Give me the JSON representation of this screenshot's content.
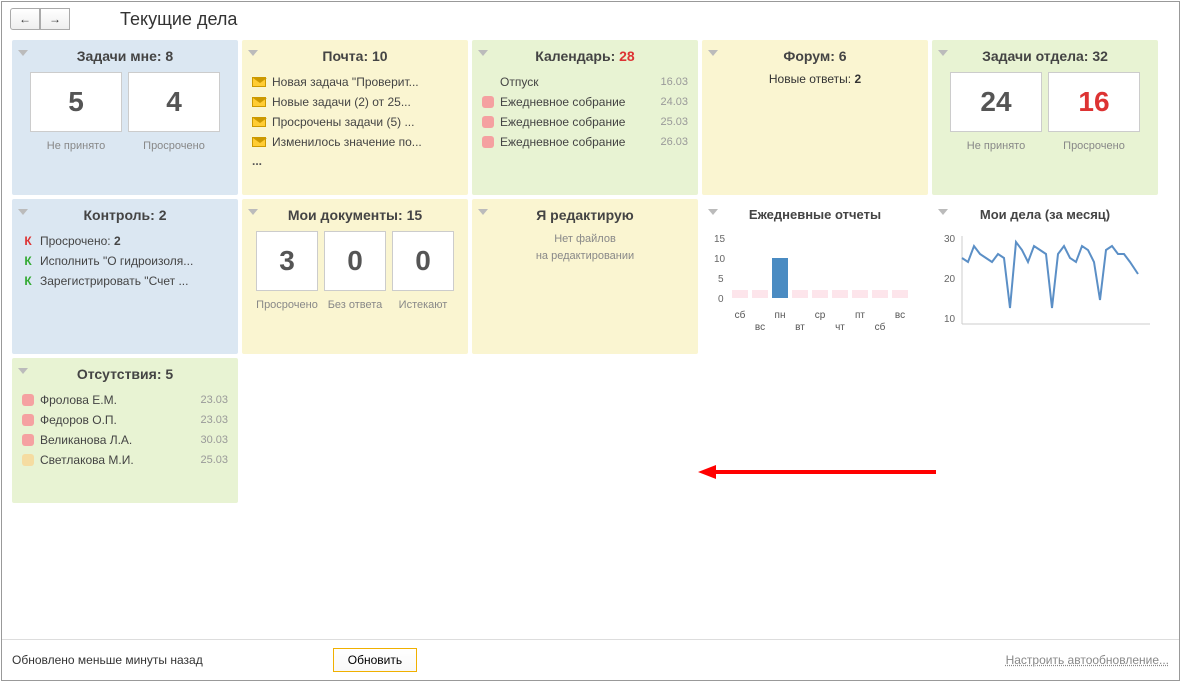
{
  "page_title": "Текущие дела",
  "nav": {
    "back": "←",
    "fwd": "→"
  },
  "panels": {
    "tasks_me": {
      "title": "Задачи мне:",
      "count": "8",
      "tiles": [
        "5",
        "4"
      ],
      "labels": [
        "Не принято",
        "Просрочено"
      ]
    },
    "mail": {
      "title": "Почта:",
      "count": "10",
      "items": [
        "Новая задача \"Проверит...",
        "Новые задачи (2) от 25...",
        "Просрочены задачи (5) ...",
        "Изменилось значение по..."
      ],
      "more": "..."
    },
    "calendar": {
      "title": "Календарь:",
      "count": "28",
      "items": [
        {
          "text": "Отпуск",
          "date": "16.03",
          "color": ""
        },
        {
          "text": "Ежедневное собрание",
          "date": "24.03",
          "color": "pink"
        },
        {
          "text": "Ежедневное собрание",
          "date": "25.03",
          "color": "pink"
        },
        {
          "text": "Ежедневное собрание",
          "date": "26.03",
          "color": "pink"
        }
      ]
    },
    "forum": {
      "title": "Форум:",
      "count": "6",
      "line": "Новые ответы:",
      "value": "2"
    },
    "tasks_dept": {
      "title": "Задачи отдела:",
      "count": "32",
      "tiles": [
        "24",
        "16"
      ],
      "labels": [
        "Не принято",
        "Просрочено"
      ]
    },
    "control": {
      "title": "Контроль:",
      "count": "2",
      "items": [
        {
          "k": "red",
          "text": "Просрочено:",
          "bold": "2"
        },
        {
          "k": "green",
          "text": "Исполнить \"О гидроизоля..."
        },
        {
          "k": "green",
          "text": "Зарегистрировать \"Счет ..."
        }
      ]
    },
    "mydocs": {
      "title": "Мои документы:",
      "count": "15",
      "tiles": [
        "3",
        "0",
        "0"
      ],
      "labels": [
        "Просрочено",
        "Без ответа",
        "Истекают"
      ]
    },
    "editing": {
      "title": "Я редактирую",
      "msg1": "Нет файлов",
      "msg2": "на редактировании"
    },
    "daily": {
      "title": "Ежедневные отчеты"
    },
    "mydeeds": {
      "title": "Мои дела (за месяц)"
    },
    "absence": {
      "title": "Отсутствия:",
      "count": "5",
      "items": [
        {
          "color": "pink",
          "text": "Фролова Е.М.",
          "date": "23.03"
        },
        {
          "color": "pink",
          "text": "Федоров О.П.",
          "date": "23.03"
        },
        {
          "color": "pink",
          "text": "Великанова Л.А.",
          "date": "30.03"
        },
        {
          "color": "yellow",
          "text": "Светлакова М.И.",
          "date": "25.03"
        }
      ]
    }
  },
  "chart_data": [
    {
      "type": "bar",
      "title": "Ежедневные отчеты",
      "categories": [
        "сб",
        "вс",
        "пн",
        "вт",
        "ср",
        "чт",
        "пт",
        "сб",
        "вс"
      ],
      "values": [
        2,
        2,
        10,
        2,
        2,
        2,
        2,
        2,
        2
      ],
      "ylim": [
        0,
        15
      ],
      "yticks": [
        0,
        5,
        10,
        15
      ],
      "highlight_index": 2
    },
    {
      "type": "line",
      "title": "Мои дела (за месяц)",
      "x": [
        1,
        2,
        3,
        4,
        5,
        6,
        7,
        8,
        9,
        10,
        11,
        12,
        13,
        14,
        15,
        16,
        17,
        18,
        19,
        20,
        21,
        22,
        23,
        24,
        25,
        26,
        27,
        28,
        29,
        30
      ],
      "values": [
        24,
        23,
        27,
        25,
        24,
        23,
        25,
        24,
        12,
        28,
        26,
        23,
        27,
        26,
        25,
        12,
        25,
        27,
        24,
        23,
        27,
        26,
        23,
        14,
        26,
        27,
        25,
        25,
        23,
        20
      ],
      "ylim": [
        10,
        30
      ],
      "yticks": [
        10,
        20,
        30
      ]
    }
  ],
  "bottom": {
    "status": "Обновлено меньше минуты назад",
    "refresh": "Обновить",
    "config": "Настроить автообновление..."
  }
}
